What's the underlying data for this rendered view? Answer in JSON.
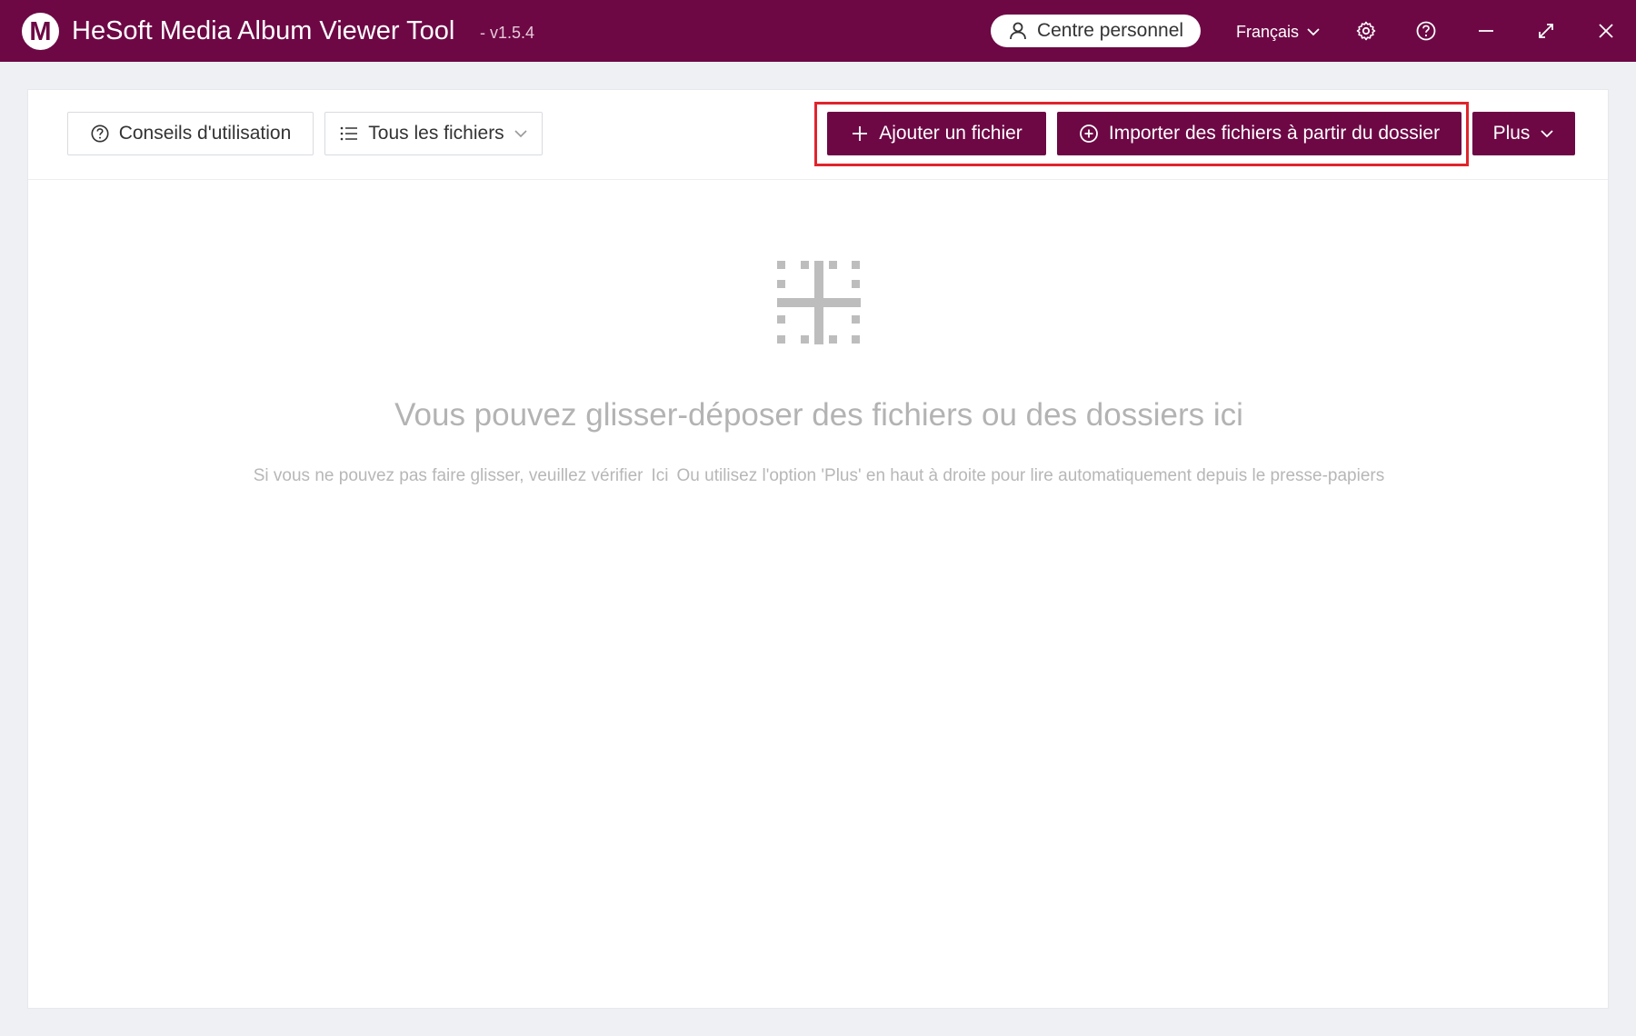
{
  "app": {
    "title": "HeSoft Media Album Viewer Tool",
    "version": "- v1.5.4",
    "logo_letter": "M"
  },
  "header": {
    "account_label": "Centre personnel",
    "language": "Français"
  },
  "toolbar": {
    "tips_label": "Conseils d'utilisation",
    "filter_label": "Tous les fichiers",
    "add_file_label": "Ajouter un fichier",
    "import_folder_label": "Importer des fichiers à partir du dossier",
    "more_label": "Plus"
  },
  "dropzone": {
    "title": "Vous pouvez glisser-déposer des fichiers ou des dossiers ici",
    "hint_before": "Si vous ne pouvez pas faire glisser, veuillez vérifier",
    "hint_link": "Ici",
    "hint_after": "Ou utilisez l'option 'Plus' en haut à droite pour lire automatiquement depuis le presse-papiers"
  },
  "icons": {
    "logo": "logo-m-icon",
    "account": "user-icon",
    "language": "chevron-down-icon",
    "settings": "gear-icon",
    "help": "question-circle-icon",
    "minimize": "minimize-icon",
    "maximize": "maximize-icon",
    "close": "close-icon",
    "tips": "question-circle-icon",
    "filter": "list-icon",
    "add_file": "plus-icon",
    "import_folder": "plus-circle-icon",
    "dropzone": "drop-grid-icon"
  },
  "colors": {
    "brand": "#6d0845",
    "highlight": "#e0242c"
  }
}
